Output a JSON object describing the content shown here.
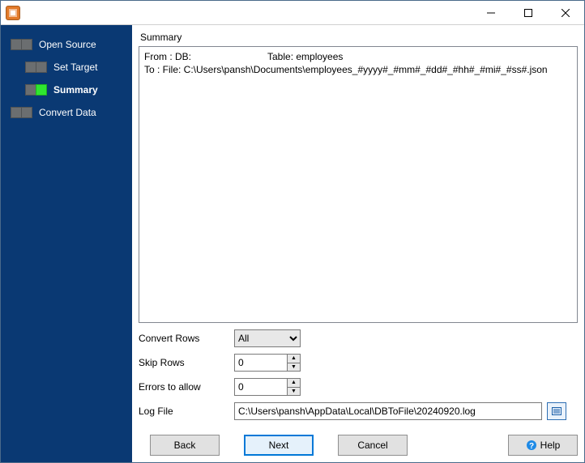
{
  "titlebar": {
    "title": ""
  },
  "sidebar": {
    "steps": [
      {
        "label": "Open Source",
        "child": false,
        "active": false
      },
      {
        "label": "Set Target",
        "child": true,
        "active": false
      },
      {
        "label": "Summary",
        "child": true,
        "active": true
      },
      {
        "label": "Convert Data",
        "child": false,
        "active": false
      }
    ]
  },
  "summary": {
    "heading": "Summary",
    "from_prefix": "From : DB:",
    "from_table": "Table: employees",
    "to_line": "To : File: C:\\Users\\pansh\\Documents\\employees_#yyyy#_#mm#_#dd#_#hh#_#mi#_#ss#.json"
  },
  "options": {
    "convert_rows_label": "Convert Rows",
    "convert_rows_value": "All",
    "skip_rows_label": "Skip Rows",
    "skip_rows_value": "0",
    "errors_label": "Errors to allow",
    "errors_value": "0",
    "log_label": "Log File",
    "log_value": "C:\\Users\\pansh\\AppData\\Local\\DBToFile\\20240920.log"
  },
  "buttons": {
    "back": "Back",
    "next": "Next",
    "cancel": "Cancel",
    "help": "Help"
  }
}
